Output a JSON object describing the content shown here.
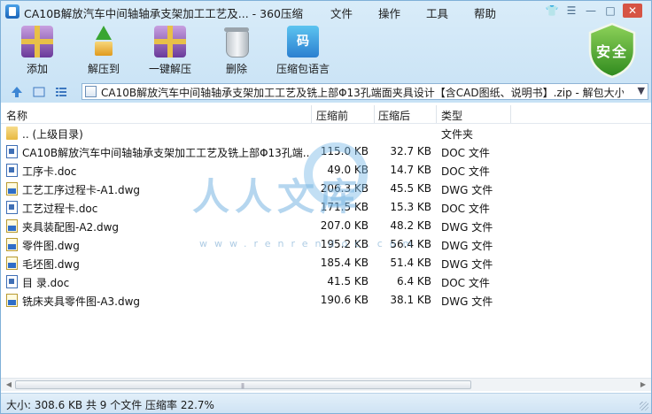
{
  "window": {
    "title": "CA10B解放汽车中间轴轴承支架加工工艺及... - 360压缩",
    "menu": [
      "文件",
      "操作",
      "工具",
      "帮助"
    ],
    "controls": {
      "skin": "👕",
      "menu": "☰",
      "minimize": "—",
      "maximize": "□",
      "close": "✕"
    }
  },
  "toolbar": {
    "items": [
      {
        "label": "添加",
        "icon": "add-archive-icon"
      },
      {
        "label": "解压到",
        "icon": "extract-to-icon"
      },
      {
        "label": "一键解压",
        "icon": "one-click-extract-icon"
      },
      {
        "label": "删除",
        "icon": "trash-icon"
      },
      {
        "label": "压缩包语言",
        "icon": "archive-language-icon",
        "glyph": "码"
      }
    ],
    "security_badge": "安全"
  },
  "address": {
    "path": "CA10B解放汽车中间轴轴承支架加工工艺及铣上部Φ13孔端面夹具设计【含CAD图纸、说明书】.zip - 解包大小"
  },
  "columns": {
    "name": "名称",
    "size": "压缩前",
    "compressed": "压缩后",
    "type": "类型"
  },
  "files": [
    {
      "name": ".. (上级目录)",
      "size": "",
      "compressed": "",
      "type": "文件夹",
      "icon": "folder"
    },
    {
      "name": "CA10B解放汽车中间轴轴承支架加工工艺及铣上部Φ13孔端...",
      "size": "115.0 KB",
      "compressed": "32.7 KB",
      "type": "DOC 文件",
      "icon": "doc"
    },
    {
      "name": "工序卡.doc",
      "size": "49.0 KB",
      "compressed": "14.7 KB",
      "type": "DOC 文件",
      "icon": "doc"
    },
    {
      "name": "工艺工序过程卡-A1.dwg",
      "size": "206.3 KB",
      "compressed": "45.5 KB",
      "type": "DWG 文件",
      "icon": "dwg"
    },
    {
      "name": "工艺过程卡.doc",
      "size": "171.5 KB",
      "compressed": "15.3 KB",
      "type": "DOC 文件",
      "icon": "doc"
    },
    {
      "name": "夹具装配图-A2.dwg",
      "size": "207.0 KB",
      "compressed": "48.2 KB",
      "type": "DWG 文件",
      "icon": "dwg"
    },
    {
      "name": "零件图.dwg",
      "size": "195.2 KB",
      "compressed": "56.4 KB",
      "type": "DWG 文件",
      "icon": "dwg"
    },
    {
      "name": "毛坯图.dwg",
      "size": "185.4 KB",
      "compressed": "51.4 KB",
      "type": "DWG 文件",
      "icon": "dwg"
    },
    {
      "name": "目 录.doc",
      "size": "41.5 KB",
      "compressed": "6.4 KB",
      "type": "DOC 文件",
      "icon": "doc"
    },
    {
      "name": "铣床夹具零件图-A3.dwg",
      "size": "190.6 KB",
      "compressed": "38.1 KB",
      "type": "DWG 文件",
      "icon": "dwg"
    }
  ],
  "watermark": {
    "text": "人人文库",
    "url": "www.renrendoc.com"
  },
  "status": {
    "text": "大小: 308.6 KB 共 9 个文件 压缩率 22.7%"
  }
}
